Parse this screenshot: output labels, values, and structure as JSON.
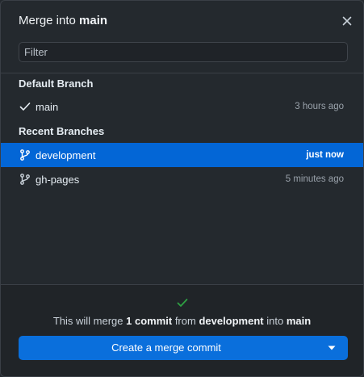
{
  "header": {
    "title_prefix": "Merge into",
    "title_branch": "main",
    "close_icon": "close-icon"
  },
  "filter": {
    "placeholder": "Filter",
    "value": ""
  },
  "default_section": {
    "label": "Default Branch",
    "branch": {
      "name": "main",
      "time": "3 hours ago",
      "icon": "check-icon"
    }
  },
  "recent_section": {
    "label": "Recent Branches",
    "branches": [
      {
        "name": "development",
        "time": "just now",
        "icon": "git-branch-icon",
        "selected": true
      },
      {
        "name": "gh-pages",
        "time": "5 minutes ago",
        "icon": "git-branch-icon",
        "selected": false
      }
    ]
  },
  "footer": {
    "status_icon": "check-icon",
    "summary_1": "This will merge ",
    "summary_count": "1 commit",
    "summary_2": " from ",
    "summary_source": "development",
    "summary_3": " into ",
    "summary_target": "main",
    "button_label": "Create a merge commit",
    "dropdown_icon": "caret-down-icon"
  },
  "colors": {
    "background": "#24292e",
    "selected_row": "#0366d6",
    "button": "#0a6fdc",
    "success": "#2ea043"
  }
}
